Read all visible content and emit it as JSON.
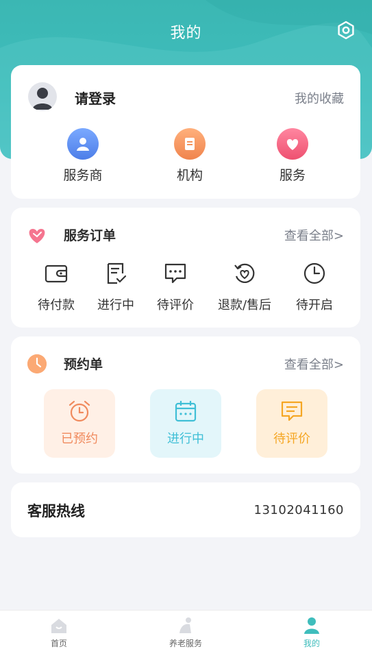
{
  "header": {
    "title": "我的"
  },
  "profile": {
    "login_label": "请登录",
    "favorites_link": "我的收藏",
    "shortcuts": [
      {
        "label": "服务商",
        "icon": "provider-icon",
        "color": "#5b8ef0"
      },
      {
        "label": "机构",
        "icon": "institution-icon",
        "color": "#f5945c"
      },
      {
        "label": "服务",
        "icon": "heart-icon",
        "color": "#f0607a"
      }
    ]
  },
  "service_orders": {
    "title": "服务订单",
    "view_all": "查看全部>",
    "items": [
      {
        "label": "待付款",
        "icon": "wallet-icon"
      },
      {
        "label": "进行中",
        "icon": "checklist-icon"
      },
      {
        "label": "待评价",
        "icon": "comment-icon"
      },
      {
        "label": "退款/售后",
        "icon": "refund-icon"
      },
      {
        "label": "待开启",
        "icon": "clock-icon"
      }
    ]
  },
  "appointments": {
    "title": "预约单",
    "view_all": "查看全部>",
    "items": [
      {
        "label": "已预约",
        "icon": "alarm-clock-icon",
        "color": "#f08a5d",
        "bg": "#fff0e6"
      },
      {
        "label": "进行中",
        "icon": "calendar-icon",
        "color": "#3fbfd6",
        "bg": "#e3f6fa"
      },
      {
        "label": "待评价",
        "icon": "chat-icon",
        "color": "#f5a623",
        "bg": "#ffefd9"
      }
    ]
  },
  "hotline": {
    "title": "客服热线",
    "number": "13102041160"
  },
  "tabbar": {
    "tabs": [
      {
        "label": "首页",
        "icon": "home-icon"
      },
      {
        "label": "养老服务",
        "icon": "elderly-service-icon"
      },
      {
        "label": "我的",
        "icon": "profile-icon",
        "active": true
      }
    ],
    "active_color": "#3fbdbc"
  }
}
